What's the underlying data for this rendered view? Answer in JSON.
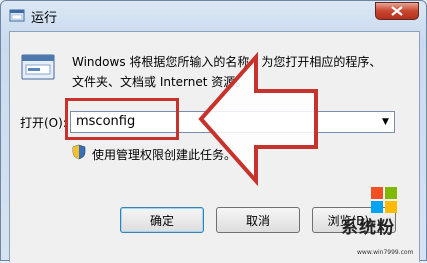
{
  "window": {
    "title": "运行"
  },
  "dialog": {
    "description_line1": "Windows 将根据您所输入的名称，为您打开相应的程序、",
    "description_line2": "文件夹、文档或 Internet 资源。",
    "open_label": "打开(O):",
    "command_value": "msconfig",
    "admin_note": "使用管理权限创建此任务。"
  },
  "buttons": {
    "ok": "确定",
    "cancel": "取消",
    "browse": "浏览(B)..."
  },
  "watermark": {
    "brand": "系统粉",
    "site": "www.win7999.com"
  },
  "colors": {
    "annotation_red": "#c8322d",
    "close_red": "#c7472f"
  }
}
